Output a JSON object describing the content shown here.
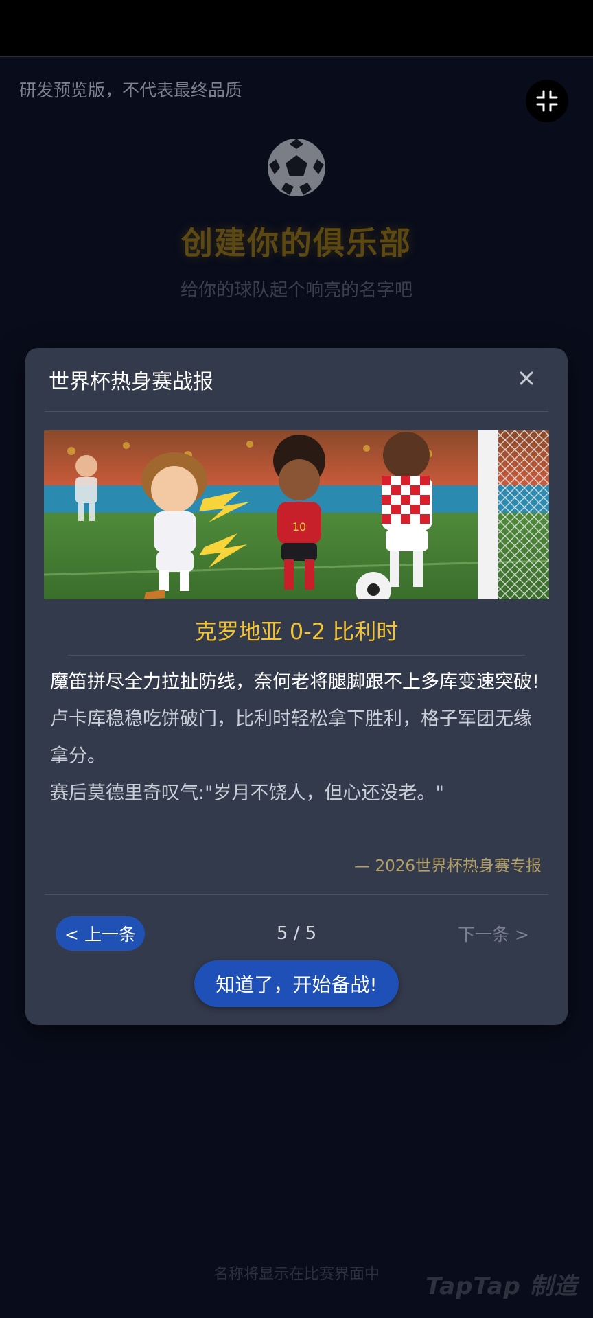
{
  "watermark": "研发预览版，不代表最终品质",
  "background": {
    "title": "创建你的俱乐部",
    "subtitle": "给你的球队起个响亮的名字吧",
    "footer_hint": "名称将显示在比赛界面中",
    "brand": "TapTap 制造"
  },
  "modal": {
    "title": "世界杯热身赛战报",
    "image_alt": "cartoon football players from Croatia and Belgium chasing the ball near the goal",
    "headline": "克罗地亚 0-2 比利时",
    "story_lines": [
      "魔笛拼尽全力拉扯防线，奈何老将腿脚跟不上多库变速突破!",
      "卢卡库稳稳吃饼破门，比利时轻松拿下胜利，格子军团无缘拿分。",
      "赛后莫德里奇叹气:\"岁月不饶人，但心还没老。\""
    ],
    "source": "— 2026世界杯热身赛专报",
    "prev_label": "< 上一条",
    "page_indicator": "5 / 5",
    "next_label": "下一条 >",
    "confirm_label": "知道了，开始备战!"
  },
  "colors": {
    "accent_gold": "#f2c232",
    "primary_blue": "#2052b6",
    "modal_bg": "#333a4b",
    "page_bg": "#090d1b"
  },
  "icons": {
    "exit_fullscreen": "exit-fullscreen-icon",
    "close": "close-icon",
    "ball": "soccer-ball-icon"
  }
}
